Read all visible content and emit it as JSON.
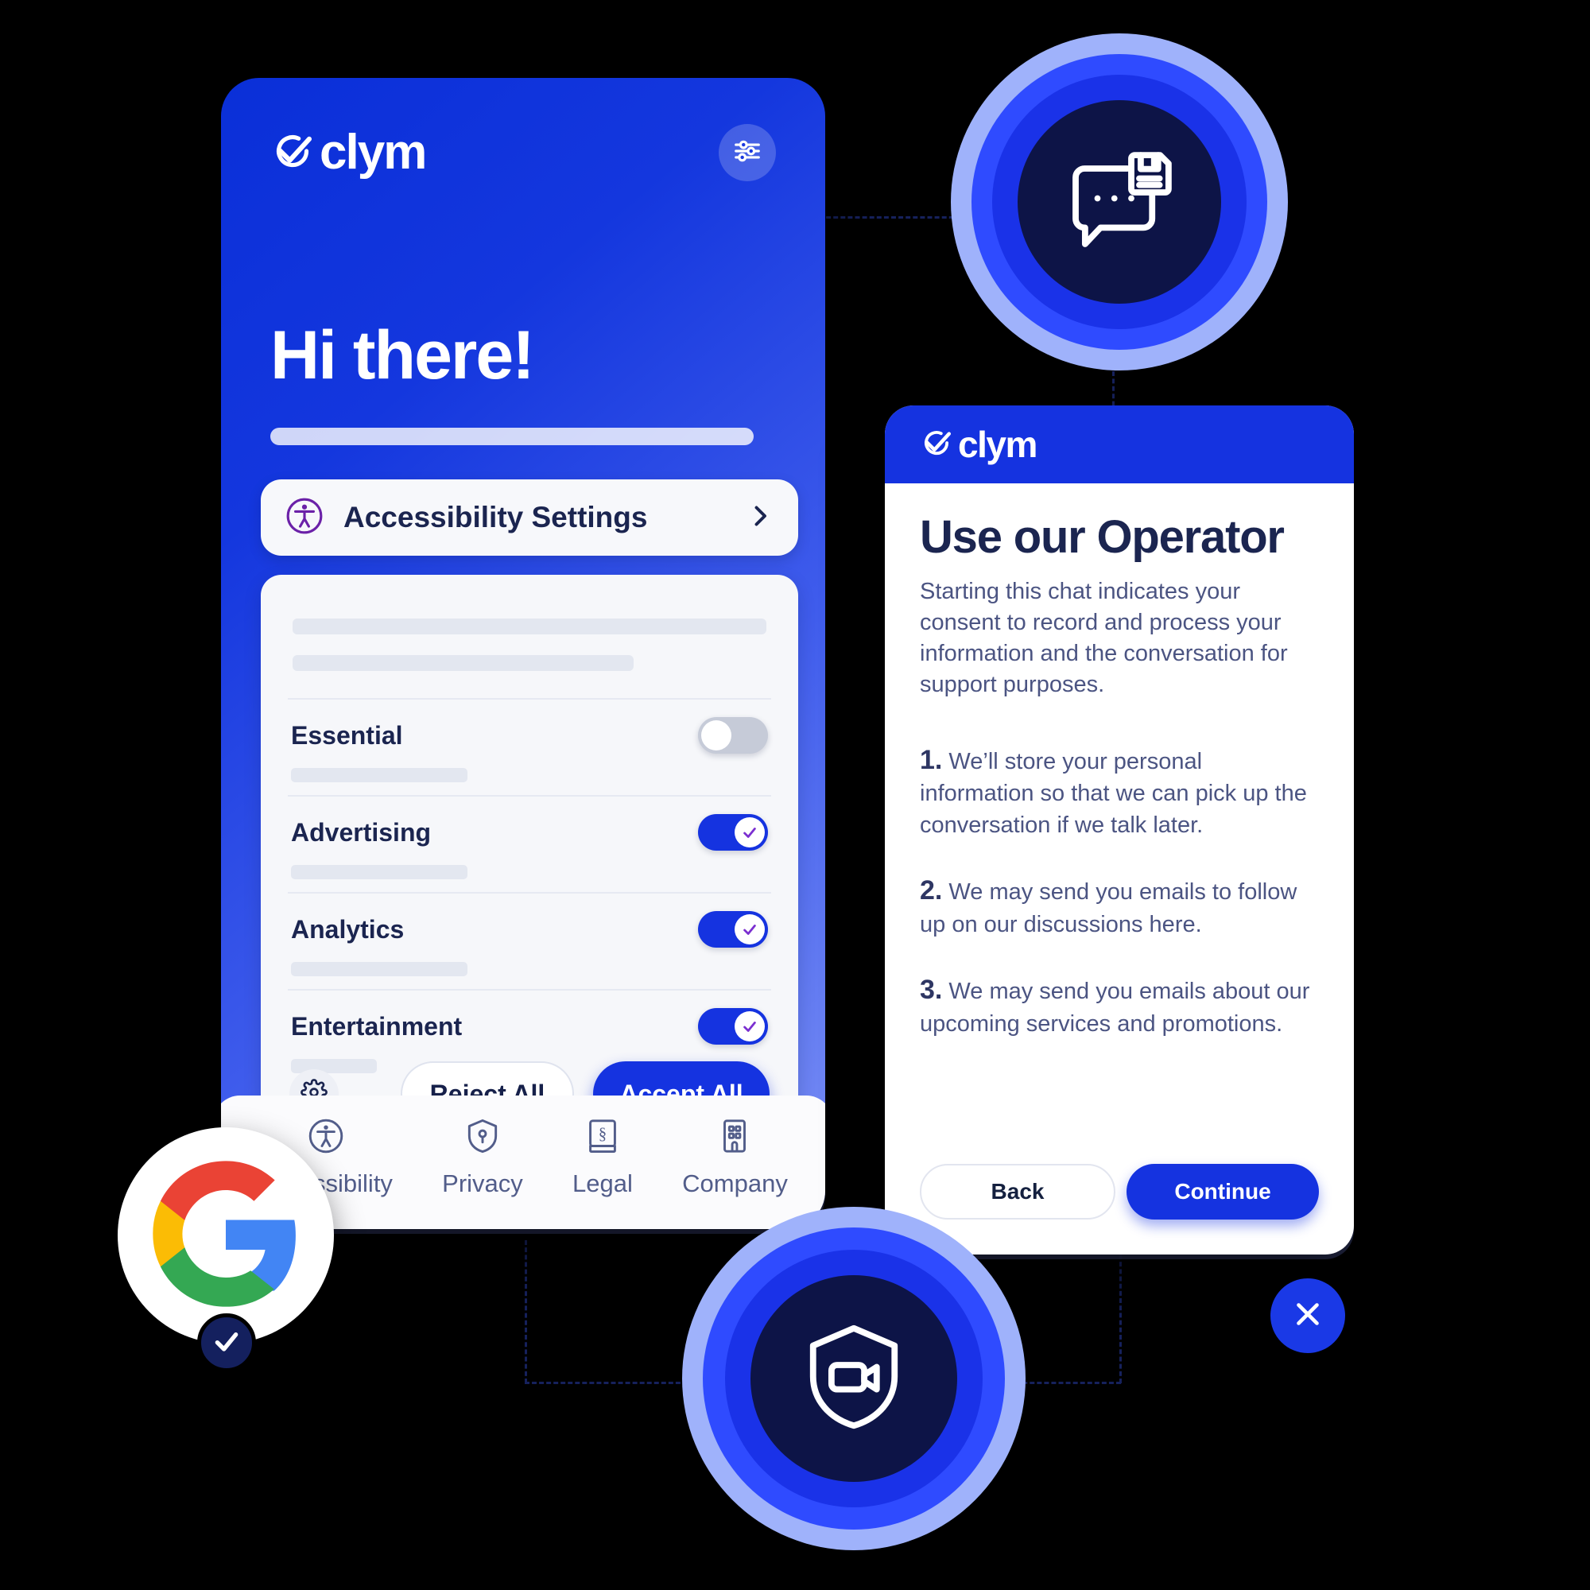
{
  "brand": {
    "name": "clym",
    "accent": "#1533e0",
    "dark": "#0d1447",
    "ink": "#1b2550"
  },
  "consent_banner": {
    "logo_text": "clym",
    "settings_icon": "sliders-icon",
    "greeting": "Hi there!",
    "accessibility": {
      "label": "Accessibility Settings",
      "icon": "accessibility-icon",
      "chevron": "chevron-right-icon"
    },
    "categories": [
      {
        "name": "Essential",
        "enabled": false
      },
      {
        "name": "Advertising",
        "enabled": true
      },
      {
        "name": "Analytics",
        "enabled": true
      },
      {
        "name": "Entertainment",
        "enabled": true
      }
    ],
    "actions": {
      "gear_icon": "gear-icon",
      "reject_label": "Reject All",
      "accept_label": "Accept All"
    },
    "nav": [
      {
        "label": "Accessibility",
        "icon": "accessibility-icon"
      },
      {
        "label": "Privacy",
        "icon": "shield-keyhole-icon"
      },
      {
        "label": "Legal",
        "icon": "law-book-icon"
      },
      {
        "label": "Company",
        "icon": "building-icon"
      }
    ]
  },
  "operator_panel": {
    "logo_text": "clym",
    "title": "Use our Operator",
    "intro": "Starting this chat indicates your consent to record and process your information and the conversation for support purposes.",
    "items": [
      {
        "num": "1.",
        "text": "We’ll store your personal information so that we can pick up the conversation if we talk later."
      },
      {
        "num": "2.",
        "text": "We may send you emails to follow up on our discussions here."
      },
      {
        "num": "3.",
        "text": "We may send you emails about our upcoming services and promotions."
      }
    ],
    "back_label": "Back",
    "continue_label": "Continue"
  },
  "badges": {
    "chat_save": {
      "icon": "chat-save-icon"
    },
    "shield_video": {
      "icon": "shield-video-icon"
    }
  },
  "google_chip": {
    "icon": "google-logo-icon",
    "check_icon": "check-icon"
  },
  "close_button": {
    "icon": "close-icon"
  }
}
